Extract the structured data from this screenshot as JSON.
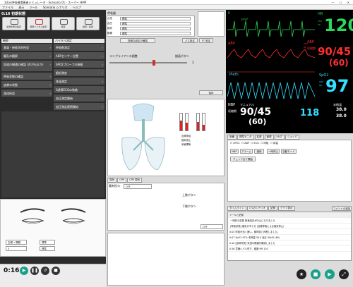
{
  "window": {
    "title": "3次元呼吸循環患者シミュレータ - Scenario 01 - スーパー HMP",
    "controls": "— ☐ ✕"
  },
  "menu": [
    "ファイル",
    "表示",
    "ツール",
    "Scenario シナリオ",
    "ヘルプ"
  ],
  "scenario": {
    "time_title": "0:16 初期状態",
    "toolbar": [
      {
        "label": "患者状態の設定",
        "icon": "patient-icon"
      },
      {
        "label": "標準バイタル設定",
        "icon": "heart-icon"
      },
      {
        "label": "検査",
        "icon": "monitor-icon"
      },
      {
        "label": "検査・処置",
        "icon": "syringe-icon"
      }
    ]
  },
  "left_panel": {
    "section1": "観察",
    "section2": "バイタル測定",
    "left_categories": [
      "意識・神経学的所見",
      "瞳孔の観察",
      "気道の開通の確認 (声が出るか)",
      "呼吸状態の確認",
      "皮膚の状態",
      "身体所見"
    ],
    "right_categories": [
      "呼吸数測定",
      "ABPセンサー位置",
      "SPO2プローブの装着",
      "脈拍測定",
      "体温測定",
      "3誘導ECGの装着",
      "血圧測定開始",
      "血圧測定連続開始"
    ],
    "face_controls": [
      {
        "label": "右眼 • 開眼",
        "value": "5"
      },
      {
        "label": "標準",
        "value": ""
      },
      {
        "label": "標準",
        "value": ""
      }
    ],
    "playback_time": "0:16"
  },
  "middle_panel": {
    "section": "呼吸器",
    "params": [
      {
        "label": "心拍",
        "value": "標準"
      },
      {
        "label": "血圧",
        "value": "標準"
      },
      {
        "label": "換気",
        "value": "標準"
      },
      {
        "label": "酸素",
        "value": "標準"
      }
    ],
    "detail_button": "詳細な設定の確認",
    "buttons": [
      "パス設定",
      "FT 設定"
    ],
    "slider_label": "コンプライアンス調整",
    "slider_value": "3",
    "checkbox_label": "描画ボタン",
    "checkbox_label2": "保存",
    "lung_controls": [
      "自発呼吸",
      "換気停止",
      "気管挿管"
    ],
    "bottom_tabs": [
      "換気",
      "CPR",
      "CPR 換気"
    ],
    "drug_label": "薬剤投与",
    "drug_select": "OFF",
    "bottom_rows": [
      "上肢ボタン",
      "下肢ボタン"
    ],
    "bottom_select": "OFF"
  },
  "monitor": {
    "lead": "II",
    "imv": "ImV",
    "hr_label": "HR",
    "hr_scale": "150\n50",
    "hr_value": "120",
    "abp_label": "ABP",
    "abp_scale": "200\n80",
    "abp_label2": "ABP",
    "abp_sub": "収縮期",
    "abp_values": "90/45",
    "abp_mean": "(60)",
    "pleth_label": "Pleth",
    "spo2_label": "SpO2",
    "spo2_scale": "100\n90",
    "spo2_value": "97",
    "nbp_label": "NBP",
    "nbp_mode": "マニュアル",
    "nbp_sub": "収縮期",
    "nbp_values": "90/45",
    "nbp_mean": "(60)",
    "nbp_extra": "118",
    "temp_label": "末梢温",
    "temp1": "38.0",
    "temp2": "38.0"
  },
  "right_panel": {
    "tabs": [
      "設備",
      "標準モニタ",
      "拡張",
      "管理",
      "FAST",
      "ショック"
    ],
    "checkboxes": [
      "SPO2",
      "ABP",
      "ECG",
      "呼吸",
      "体温"
    ],
    "nbp_buttons": [
      "NBP",
      "アラーム",
      "連続",
      "一時停止",
      "自動モード"
    ],
    "action_button": "チェック全て開始",
    "log_tabs": [
      "タイムライン",
      "1つのシナリオ",
      "記録",
      "グラフ表示"
    ],
    "log_button": "コメントの追加",
    "log_header": "ツールと記録",
    "log_entries": [
      {
        "time": "",
        "text": "一時的な変更 検査設定が中止になりました"
      },
      {
        "time": "",
        "text": "[呼吸状態] 換気が不十分 (自発呼吸による換気停止)"
      },
      {
        "time": "0:03",
        "text": "呼吸が浅く速い。頻呼吸と判断しました。"
      },
      {
        "time": "0:07",
        "text": "SpO2 97% 末梢温 38.0 血圧 90/45 (60)"
      },
      {
        "time": "0:10",
        "text": "[身体所見] 気道の開通を確認しました"
      },
      {
        "time": "0:16",
        "text": "意識レベル低下、頻脈 HR 120"
      }
    ]
  },
  "colors": {
    "hr": "#2dd65a",
    "abp": "#ff3030",
    "spo2": "#33e0ff",
    "nbp": "#ffffff",
    "temp": "#ffffff"
  }
}
